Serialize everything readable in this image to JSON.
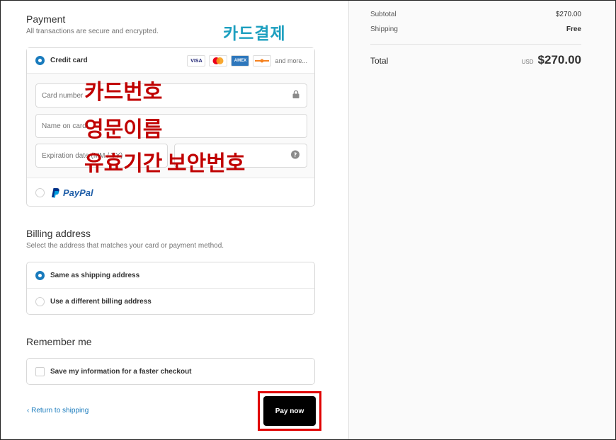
{
  "annotations": {
    "card_payment": "카드결제",
    "card_number": "카드번호",
    "english_name": "영문이름",
    "expiry": "유효기간",
    "security_code": "보안번호"
  },
  "payment": {
    "title": "Payment",
    "subtitle": "All transactions are secure and encrypted.",
    "credit_card_label": "Credit card",
    "card_brands": [
      "VISA",
      "mastercard",
      "AMEX",
      "discover"
    ],
    "and_more": "and more...",
    "card_number_placeholder": "Card number",
    "name_on_card_placeholder": "Name on card",
    "expiration_placeholder": "Expiration date (MM / YY)",
    "security_code_placeholder": "",
    "paypal_label": "PayPal"
  },
  "billing": {
    "title": "Billing address",
    "subtitle": "Select the address that matches your card or payment method.",
    "same_as_shipping": "Same as shipping address",
    "different_address": "Use a different billing address"
  },
  "remember": {
    "title": "Remember me",
    "save_info": "Save my information for a faster checkout"
  },
  "footer": {
    "return_link": "Return to shipping",
    "return_chevron": "‹",
    "pay_button": "Pay now"
  },
  "summary": {
    "subtotal_label": "Subtotal",
    "subtotal_value": "$270.00",
    "shipping_label": "Shipping",
    "shipping_value": "Free",
    "total_label": "Total",
    "currency": "USD",
    "total_value": "$270.00"
  },
  "colors": {
    "accent": "#197bbd",
    "annotation_red": "#c00000",
    "annotation_teal": "#1c9fbf",
    "highlight_frame": "#e00000"
  },
  "icons": {
    "lock": "lock-icon",
    "help": "question-circle-icon",
    "chevron": "chevron-left-icon"
  }
}
